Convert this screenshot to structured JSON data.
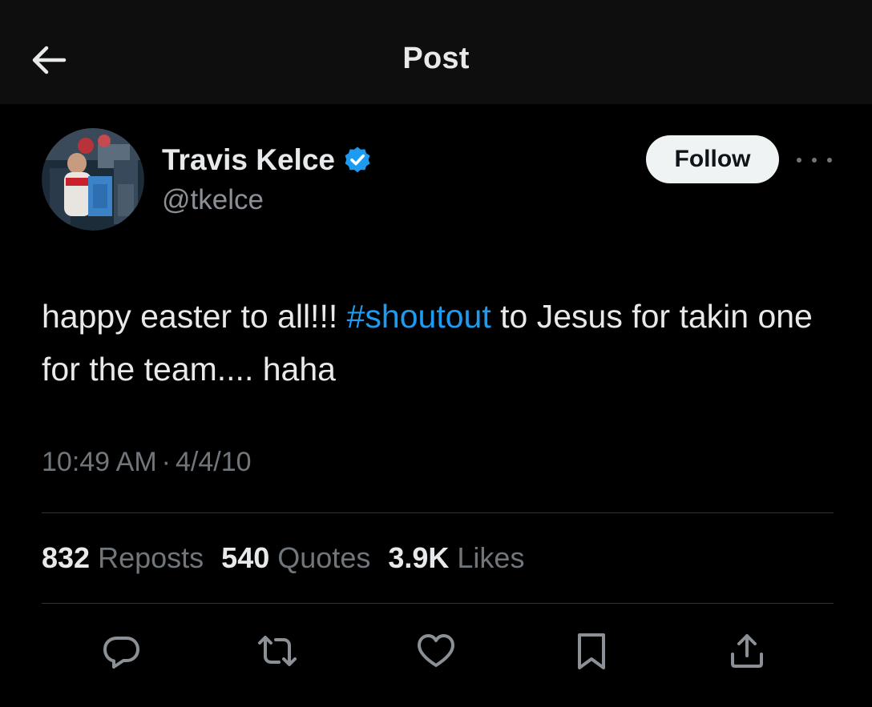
{
  "header": {
    "title": "Post",
    "back_icon": "arrow-left-icon"
  },
  "author": {
    "display_name": "Travis Kelce",
    "handle": "@tkelce",
    "verified": true,
    "verified_color": "#1d9bf0"
  },
  "follow_button": {
    "label": "Follow"
  },
  "post": {
    "text_before": "happy easter to all!!! ",
    "hashtag": "#shoutout",
    "text_after": " to Jesus for takin one for the team.... haha",
    "time": "10:49 AM",
    "separator": "·",
    "date": "4/4/10"
  },
  "stats": [
    {
      "count": "832",
      "label": "Reposts"
    },
    {
      "count": "540",
      "label": "Quotes"
    },
    {
      "count": "3.9K",
      "label": "Likes"
    }
  ],
  "actions": [
    {
      "name": "reply",
      "icon": "reply-icon"
    },
    {
      "name": "repost",
      "icon": "repost-icon"
    },
    {
      "name": "like",
      "icon": "heart-icon"
    },
    {
      "name": "bookmark",
      "icon": "bookmark-icon"
    },
    {
      "name": "share",
      "icon": "share-icon"
    }
  ],
  "colors": {
    "background": "#000000",
    "header_background": "#0e0e0e",
    "text": "#e7e9ea",
    "secondary_text": "#71767b",
    "link": "#1d9bf0",
    "follow_button_bg": "#eff3f4"
  }
}
